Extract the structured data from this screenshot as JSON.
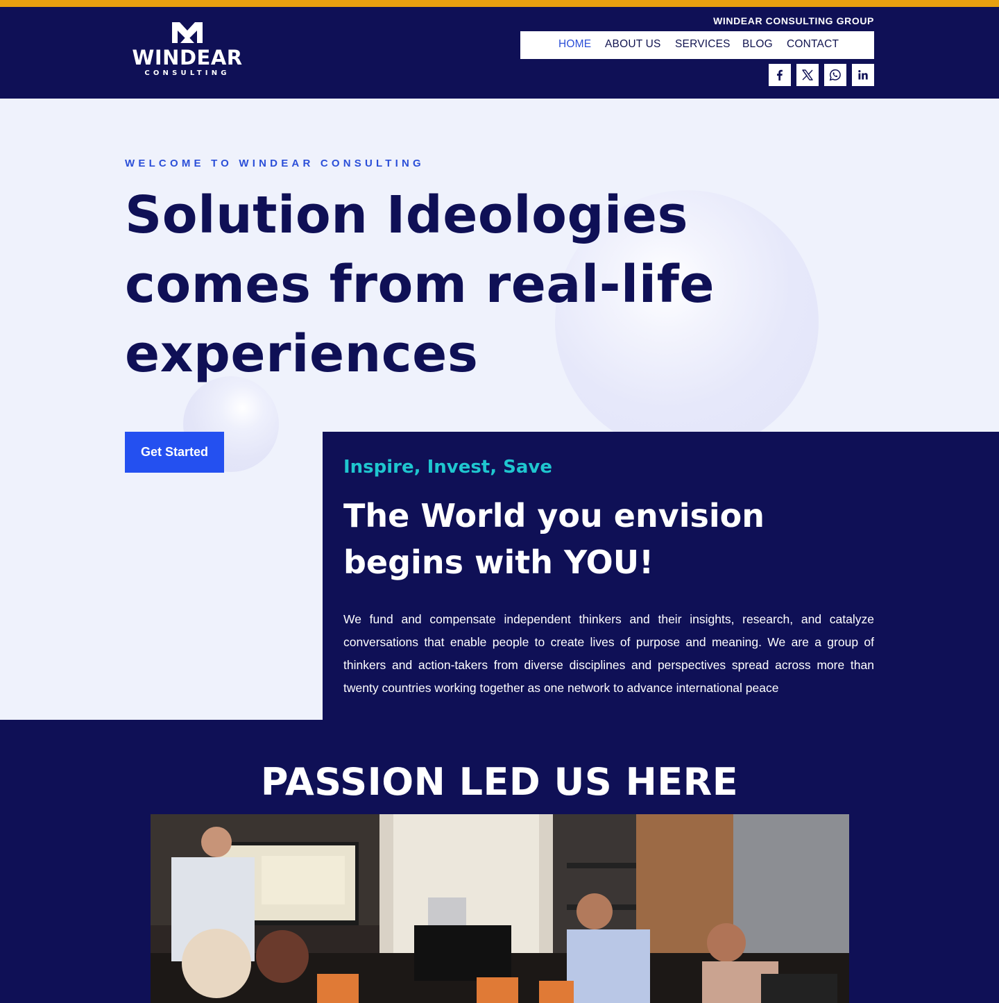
{
  "colors": {
    "accent_bar": "#e8a010",
    "navy": "#0f1056",
    "hero_bg": "#eff2fc",
    "link_blue": "#2b4fd8",
    "button_blue": "#2450f0",
    "teal": "#1fc6cf"
  },
  "header": {
    "logo": {
      "wordmark": "WINDEAR",
      "subtext": "CONSULTING",
      "icon": "crown-logo-icon"
    },
    "group_name": "WINDEAR CONSULTING GROUP",
    "nav": [
      {
        "label": "HOME",
        "active": true
      },
      {
        "label": "ABOUT US",
        "active": false
      },
      {
        "label": "SERVICES",
        "active": false
      },
      {
        "label": "BLOG",
        "active": false
      },
      {
        "label": "CONTACT",
        "active": false
      }
    ],
    "social": [
      {
        "icon": "facebook-icon"
      },
      {
        "icon": "x-twitter-icon"
      },
      {
        "icon": "whatsapp-icon"
      },
      {
        "icon": "linkedin-icon"
      }
    ]
  },
  "hero": {
    "eyebrow": "WELCOME TO WINDEAR CONSULTING",
    "headline": [
      "Solution Ideologies",
      "comes from real-life",
      "experiences"
    ],
    "cta": "Get Started"
  },
  "panel": {
    "kicker": "Inspire, Invest, Save",
    "title": [
      "The World you envision",
      "begins with YOU!"
    ],
    "body": "We fund and compensate independent thinkers and their insights, research, and catalyze conversations that enable people to create lives of purpose and meaning. We are a group of thinkers and action-takers from diverse disciplines and perspectives spread across more than twenty countries working together as one network to advance international peace"
  },
  "passion": {
    "title": "PASSION LED US HERE",
    "photo": "team-meeting-photo"
  }
}
